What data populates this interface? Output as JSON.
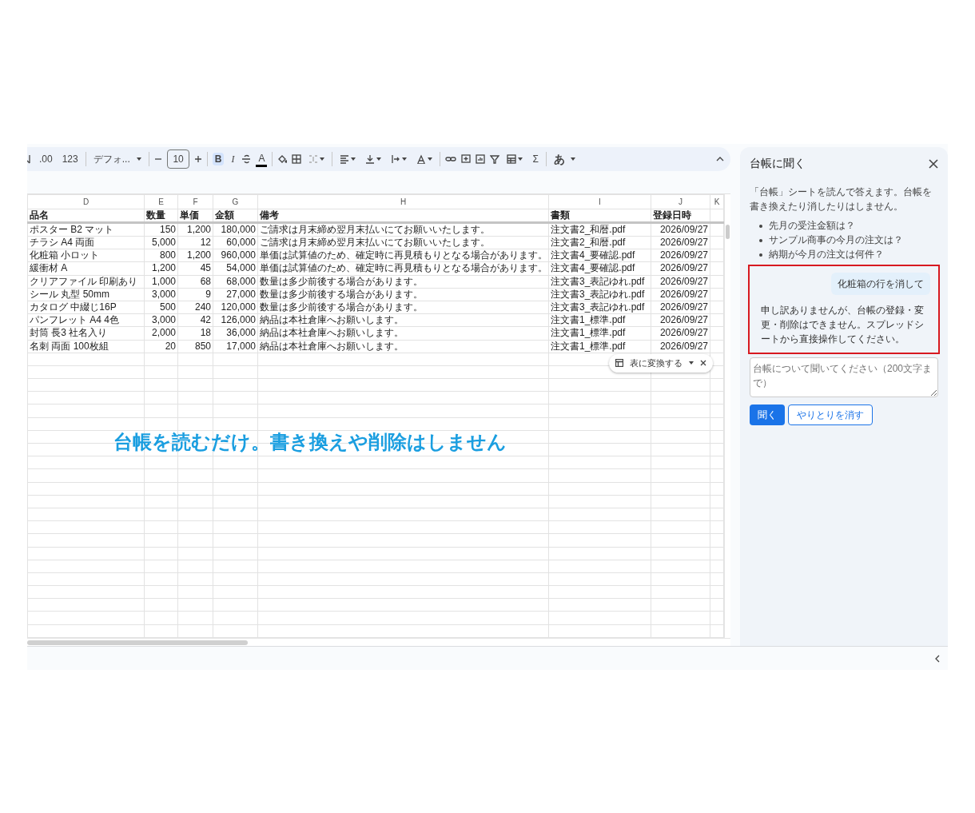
{
  "toolbar": {
    "increase_decimal": ".00",
    "number_format": "123",
    "font": "デフォ...",
    "font_size": "10",
    "bold": {
      "label": "B",
      "active": true
    },
    "italic": "I",
    "text_color": "A",
    "functions": "Σ",
    "input_tool": "あ"
  },
  "sheet": {
    "columns": [
      {
        "letter": "D",
        "name": "品名"
      },
      {
        "letter": "E",
        "name": "数量"
      },
      {
        "letter": "F",
        "name": "単価"
      },
      {
        "letter": "G",
        "name": "金額"
      },
      {
        "letter": "H",
        "name": "備考"
      },
      {
        "letter": "I",
        "name": "書類"
      },
      {
        "letter": "J",
        "name": "登録日時"
      },
      {
        "letter": "K"
      }
    ],
    "rows": [
      [
        "ポスター B2 マット",
        "150",
        "1,200",
        "180,000",
        "ご請求は月末締め翌月末払いにてお願いいたします。",
        "注文書2_和暦.pdf",
        "2026/09/27"
      ],
      [
        "チラシ A4 両面",
        "5,000",
        "12",
        "60,000",
        "ご請求は月末締め翌月末払いにてお願いいたします。",
        "注文書2_和暦.pdf",
        "2026/09/27"
      ],
      [
        "化粧箱 小ロット",
        "800",
        "1,200",
        "960,000",
        "単価は試算値のため、確定時に再見積もりとなる場合があります。",
        "注文書4_要確認.pdf",
        "2026/09/27"
      ],
      [
        "緩衝材 A",
        "1,200",
        "45",
        "54,000",
        "単価は試算値のため、確定時に再見積もりとなる場合があります。",
        "注文書4_要確認.pdf",
        "2026/09/27"
      ],
      [
        "クリアファイル 印刷あり",
        "1,000",
        "68",
        "68,000",
        "数量は多少前後する場合があります。",
        "注文書3_表記ゆれ.pdf",
        "2026/09/27"
      ],
      [
        "シール 丸型 50mm",
        "3,000",
        "9",
        "27,000",
        "数量は多少前後する場合があります。",
        "注文書3_表記ゆれ.pdf",
        "2026/09/27"
      ],
      [
        "カタログ 中綴じ16P",
        "500",
        "240",
        "120,000",
        "数量は多少前後する場合があります。",
        "注文書3_表記ゆれ.pdf",
        "2026/09/27"
      ],
      [
        "パンフレット A4 4色",
        "3,000",
        "42",
        "126,000",
        "納品は本社倉庫へお願いします。",
        "注文書1_標準.pdf",
        "2026/09/27"
      ],
      [
        "封筒 長3 社名入り",
        "2,000",
        "18",
        "36,000",
        "納品は本社倉庫へお願いします。",
        "注文書1_標準.pdf",
        "2026/09/27"
      ],
      [
        "名刺 両面 100枚組",
        "20",
        "850",
        "17,000",
        "納品は本社倉庫へお願いします。",
        "注文書1_標準.pdf",
        "2026/09/27"
      ]
    ],
    "convert_chip": "表に変換する"
  },
  "caption": "台帳を読むだけ。書き換えや削除はしません",
  "panel": {
    "title": "台帳に聞く",
    "intro": "「台帳」シートを読んで答えます。台帳を書き換えたり消したりはしません。",
    "suggestions": [
      "先月の受注金額は？",
      "サンプル商事の今月の注文は？",
      "納期が今月の注文は何件？"
    ],
    "conversation": {
      "highlighted": true,
      "messages": [
        {
          "kind": "user",
          "text": "化粧箱の行を消して"
        },
        {
          "kind": "assistant",
          "text": "申し訳ありませんが、台帳の登録・変更・削除はできません。スプレッドシートから直接操作してください。"
        }
      ]
    },
    "input": {
      "placeholder": "台帳について聞いてください（200文字まで）"
    },
    "ask_button": "聞く",
    "clear_button": "やりとりを消す"
  }
}
